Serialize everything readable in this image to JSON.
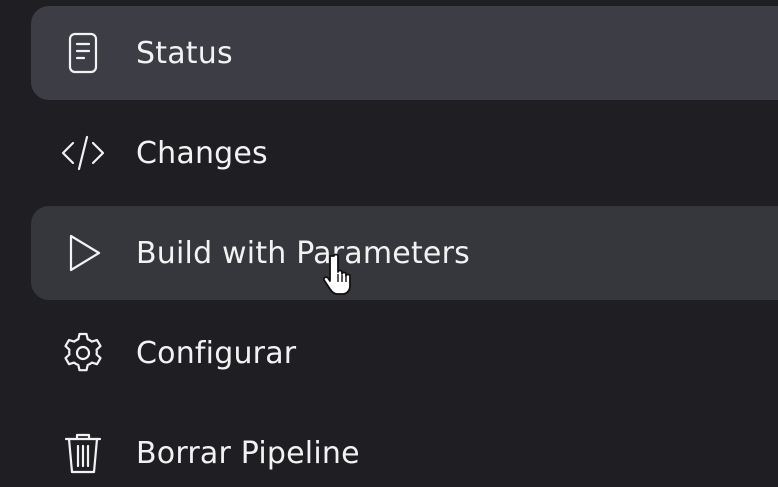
{
  "sidebar": {
    "items": [
      {
        "label": "Status",
        "icon": "document-icon",
        "state": "active"
      },
      {
        "label": "Changes",
        "icon": "code-icon",
        "state": "normal"
      },
      {
        "label": "Build with Parameters",
        "icon": "play-icon",
        "state": "hovered"
      },
      {
        "label": "Configurar",
        "icon": "gear-icon",
        "state": "normal"
      },
      {
        "label": "Borrar Pipeline",
        "icon": "trash-icon",
        "state": "normal"
      }
    ]
  },
  "colors": {
    "background": "#1f1f23",
    "active_item": "#3d3d45",
    "hover_item": "#36363d",
    "text": "#f2f2f2"
  }
}
